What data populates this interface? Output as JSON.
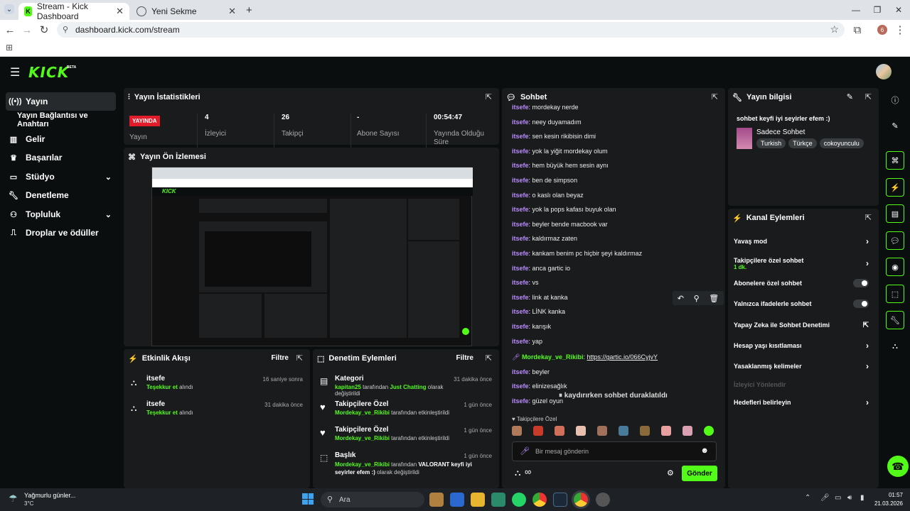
{
  "browser": {
    "tabs": [
      {
        "title": "Stream - Kick Dashboard"
      },
      {
        "title": "Yeni Sekme"
      }
    ],
    "url": "dashboard.kick.com/stream",
    "profile_initial": "6"
  },
  "kick": {
    "logo": "KICK",
    "beta": "BETA"
  },
  "sidebar": {
    "items": [
      {
        "label": "Yayın",
        "icon": "broadcast-icon"
      },
      {
        "label": "Yayın Bağlantısı ve Anahtarı"
      },
      {
        "label": "Gelir",
        "icon": "revenue-icon"
      },
      {
        "label": "Başarılar",
        "icon": "achievements-icon"
      },
      {
        "label": "Stüdyo",
        "icon": "studio-icon"
      },
      {
        "label": "Denetleme",
        "icon": "wrench-icon"
      },
      {
        "label": "Topluluk",
        "icon": "community-icon"
      },
      {
        "label": "Droplar ve ödüller",
        "icon": "drops-icon"
      }
    ]
  },
  "stats": {
    "title": "Yayın İstatistikleri",
    "live_badge": "YAYINDA",
    "items": [
      {
        "value": "",
        "label": "Yayın"
      },
      {
        "value": "4",
        "label": "İzleyici"
      },
      {
        "value": "26",
        "label": "Takipçi"
      },
      {
        "value": "-",
        "label": "Abone Sayısı"
      },
      {
        "value": "00:54:47",
        "label": "Yayında Olduğu Süre"
      }
    ]
  },
  "preview": {
    "title": "Yayın Ön İzlemesi"
  },
  "activity": {
    "title": "Etkinlik Akışı",
    "filter": "Filtre",
    "items": [
      {
        "user": "itsefe",
        "action": "Teşekkur et",
        "suffix": "alındı",
        "time": "16 saniye sonra"
      },
      {
        "user": "itsefe",
        "action": "Teşekkur et",
        "suffix": "alındı",
        "time": "31 dakika önce"
      }
    ]
  },
  "mod": {
    "title": "Denetim Eylemleri",
    "filter": "Filtre",
    "items": [
      {
        "title": "Kategori",
        "user": "kapitan25",
        "mid": "tarafından",
        "target": "Just Chatting",
        "tail": "olarak değiştirildi",
        "time": "31 dakika önce"
      },
      {
        "title": "Takipçilere Özel",
        "user": "Mordekay_ve_Rikibi",
        "mid": "tarafından etkinleştirildi",
        "target": "",
        "tail": "",
        "time": "1 gün önce"
      },
      {
        "title": "Takipçilere Özel",
        "user": "Mordekay_ve_Rikibi",
        "mid": "tarafından etkinleştirildi",
        "target": "",
        "tail": "",
        "time": "1 gün önce"
      },
      {
        "title": "Başlık",
        "user": "Mordekay_ve_Rikibi",
        "mid": "tarafından",
        "target": "VALORANT keyfi iyi seyirler efem :)",
        "tail": "olarak değiştirildi",
        "time": "1 gün önce"
      }
    ]
  },
  "chat": {
    "title": "Sohbet",
    "messages": [
      {
        "user": "itsefe",
        "text": "mordekay nerde"
      },
      {
        "user": "itsefe",
        "text": "neey duyamadım"
      },
      {
        "user": "itsefe",
        "text": "sen kesin rikibisin dimi"
      },
      {
        "user": "itsefe",
        "text": "yok la yiğit mordekay olum"
      },
      {
        "user": "itsefe",
        "text": "hem büyük hem sesin aynı"
      },
      {
        "user": "itsefe",
        "text": "ben de simpson"
      },
      {
        "user": "itsefe",
        "text": "o kaslı olan beyaz"
      },
      {
        "user": "itsefe",
        "text": "yok la pops kafası buyuk olan"
      },
      {
        "user": "itsefe",
        "text": "beyler bende macbook var"
      },
      {
        "user": "itsefe",
        "text": "kaldırmaz zaten"
      },
      {
        "user": "itsefe",
        "text": "kankam benim pc hiçbir şeyi kaldırmaz"
      },
      {
        "user": "itsefe",
        "text": "anca gartic io"
      },
      {
        "user": "itsefe",
        "text": "vs"
      },
      {
        "user": "itsefe",
        "text": "link at kanka"
      },
      {
        "user": "itsefe",
        "text": "LİNK kanka"
      },
      {
        "user": "itsefe",
        "text": "karışık"
      },
      {
        "user": "itsefe",
        "text": "yap"
      },
      {
        "user": "Mordekay_ve_Rikibi",
        "text": "https://gartic.io/066CyjvY",
        "link": true
      },
      {
        "user": "itsefe",
        "text": "beyler"
      },
      {
        "user": "itsefe",
        "text": "elinizesağlık"
      },
      {
        "user": "itsefe",
        "text": "güzel oyun"
      }
    ],
    "paused": "kaydırırken sohbet duraklatıldı",
    "emote_section": "Takipçilere Özel",
    "placeholder": "Bir mesaj gönderin",
    "send": "Gönder",
    "infinity": "∞"
  },
  "info": {
    "title": "Yayın bilgisi",
    "stream_title": "sohbet keyfi iyi seyirler efem :)",
    "category": "Sadece Sohbet",
    "tags": [
      "Turkish",
      "Türkçe",
      "cokoyunculu"
    ]
  },
  "channel": {
    "title": "Kanal Eylemleri",
    "items": [
      {
        "label": "Yavaş mod",
        "type": "arrow"
      },
      {
        "label": "Takipçilere özel sohbet",
        "sub": "1 dk.",
        "type": "arrow"
      },
      {
        "label": "Abonelere özel sohbet",
        "type": "toggle"
      },
      {
        "label": "Yalnızca ifadelerle sohbet",
        "type": "toggle"
      },
      {
        "label": "Yapay Zeka ile Sohbet Denetimi",
        "type": "external"
      },
      {
        "label": "Hesap yaşı kısıtlaması",
        "type": "arrow"
      },
      {
        "label": "Yasaklanmış kelimeler",
        "type": "arrow"
      },
      {
        "label": "İzleyici Yönlendir",
        "type": "disabled"
      },
      {
        "label": "Hedefleri belirleyin",
        "type": "arrow"
      }
    ]
  },
  "taskbar": {
    "weather": "Yağmurlu günler...",
    "temp": "3°C",
    "search": "Ara",
    "time": "01:57",
    "date": "21.03.2026"
  },
  "colors": {
    "accent": "#53fc18",
    "live": "#e21c2a",
    "username": "#b98cff",
    "panel": "#191b1c"
  }
}
